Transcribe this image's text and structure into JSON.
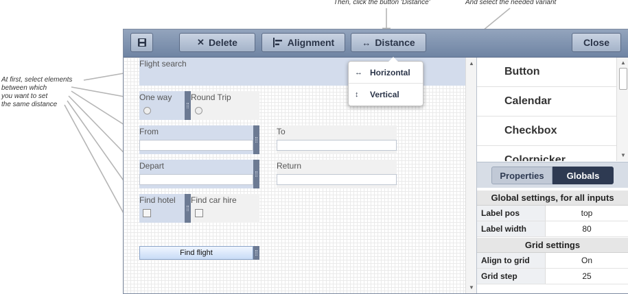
{
  "annotations": {
    "step1": [
      "At first, select elements",
      "between which",
      "you want to set",
      "the same distance"
    ],
    "step2": "Then, click the button 'Distance'",
    "step3": "And select the needed variant"
  },
  "toolbar": {
    "delete_label": "Delete",
    "alignment_label": "Alignment",
    "distance_label": "Distance",
    "close_label": "Close"
  },
  "distance_menu": {
    "items": [
      {
        "label": "Horizontal",
        "icon": "horizontal-distance-icon"
      },
      {
        "label": "Vertical",
        "icon": "vertical-distance-icon"
      }
    ]
  },
  "form": {
    "flight_search": "Flight search",
    "one_way": "One way",
    "round_trip": "Round Trip",
    "from": "From",
    "to": "To",
    "depart": "Depart",
    "return": "Return",
    "find_hotel": "Find hotel",
    "find_car_hire": "Find car hire",
    "find_flight": "Find flight"
  },
  "widgets": [
    "Button",
    "Calendar",
    "Checkbox",
    "Colorpicker"
  ],
  "tabs": {
    "properties": "Properties",
    "globals": "Globals",
    "active": "Globals"
  },
  "globals": {
    "section1_title": "Global settings, for all inputs",
    "section1_rows": [
      {
        "key": "Label pos",
        "value": "top"
      },
      {
        "key": "Label width",
        "value": "80"
      }
    ],
    "section2_title": "Grid settings",
    "section2_rows": [
      {
        "key": "Align to grid",
        "value": "On"
      },
      {
        "key": "Grid step",
        "value": "25"
      }
    ]
  },
  "colors": {
    "toolbar": "#7f92ae",
    "selection": "#d3dcec",
    "active_tab": "#2e3a52"
  }
}
